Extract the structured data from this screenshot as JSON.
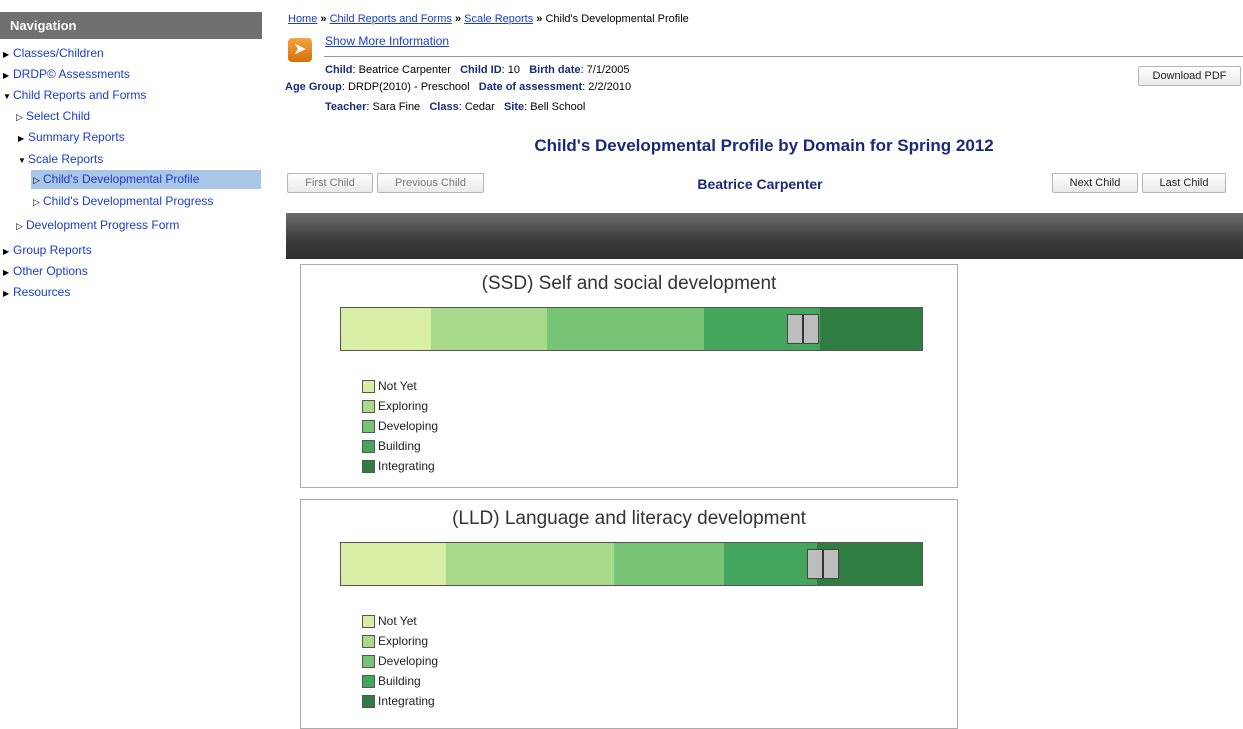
{
  "nav": {
    "header": "Navigation",
    "items": [
      {
        "label": "Classes/Children"
      },
      {
        "label": "DRDP© Assessments"
      },
      {
        "label": "Child Reports and Forms"
      },
      {
        "label": "Select Child"
      },
      {
        "label": "Summary Reports"
      },
      {
        "label": "Scale Reports"
      },
      {
        "label": "Child's Developmental Profile"
      },
      {
        "label": "Child's Developmental Progress"
      },
      {
        "label": "Development Progress Form"
      },
      {
        "label": "Group Reports"
      },
      {
        "label": "Other Options"
      },
      {
        "label": "Resources"
      }
    ]
  },
  "breadcrumb": {
    "home": "Home",
    "sep": "»",
    "crumb1": "Child Reports and Forms",
    "crumb2": "Scale Reports",
    "current": "Child's Developmental Profile"
  },
  "show_more": "Show More Information",
  "child_info": {
    "child_label": "Child",
    "child_value": ": Beatrice Carpenter",
    "id_label": "Child ID",
    "id_value": ": 10",
    "birth_label": "Birth date",
    "birth_value": ": 7/1/2005",
    "age_label": "Age Group",
    "age_value": ": DRDP(2010) - Preschool",
    "doa_label": "Date of assessment",
    "doa_value": ": 2/2/2010",
    "teacher_label": "Teacher",
    "teacher_value": ": Sara Fine",
    "class_label": "Class",
    "class_value": ": Cedar",
    "site_label": "Site",
    "site_value": ": Bell School"
  },
  "download_pdf": "Download PDF",
  "report_title": "Child's Developmental Profile by Domain for Spring 2012",
  "child_nav": {
    "first": "First Child",
    "previous": "Previous Child",
    "name": "Beatrice Carpenter",
    "next": "Next Child",
    "last": "Last Child"
  },
  "legend": [
    {
      "label": "Not Yet",
      "color": "#d8eea4"
    },
    {
      "label": "Exploring",
      "color": "#a9da8b"
    },
    {
      "label": "Developing",
      "color": "#77c477"
    },
    {
      "label": "Building",
      "color": "#43a65c"
    },
    {
      "label": "Integrating",
      "color": "#2f7d40"
    }
  ],
  "domains": [
    {
      "title": "(SSD) Self and social development",
      "segment_fractions": [
        0.155,
        0.2,
        0.27,
        0.2,
        0.175
      ],
      "marker_fraction": 0.795
    },
    {
      "title": "(LLD) Language and literacy development",
      "segment_fractions": [
        0.18,
        0.29,
        0.19,
        0.16,
        0.18
      ],
      "marker_fraction": 0.83
    }
  ]
}
